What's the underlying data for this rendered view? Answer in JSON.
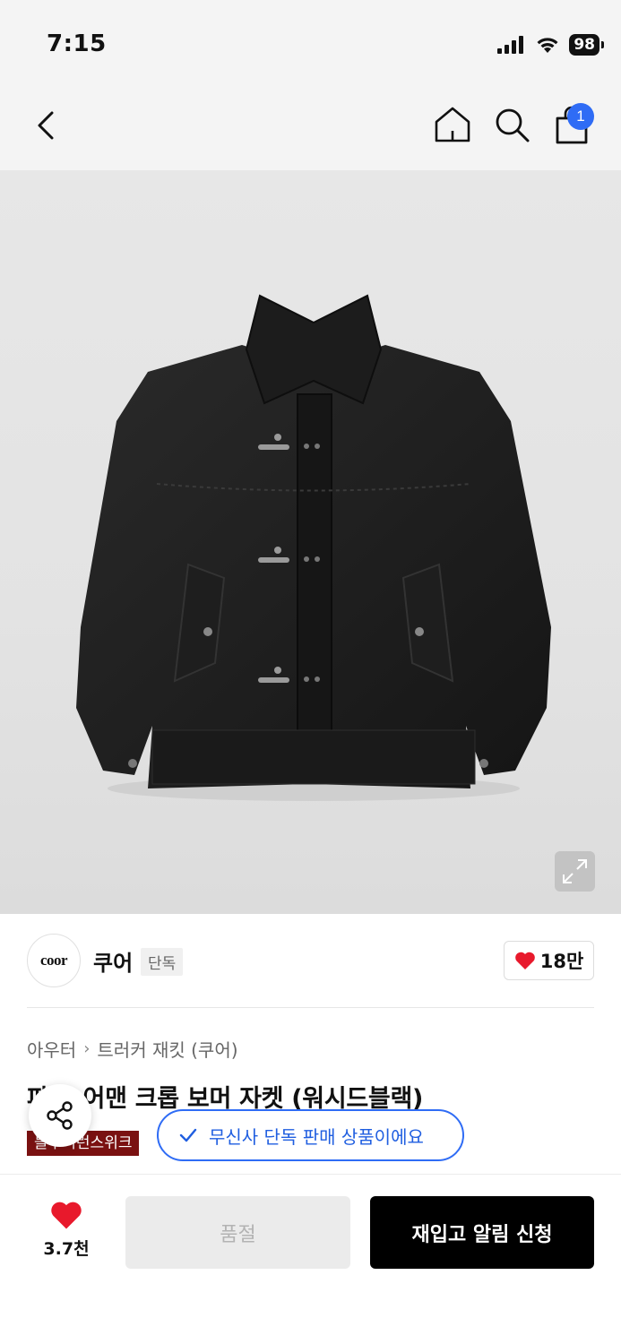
{
  "status_bar": {
    "time": "7:15",
    "battery": "98",
    "icons": [
      "cellular-signal-icon",
      "wifi-icon",
      "battery-icon"
    ]
  },
  "nav": {
    "icons": [
      "back-arrow-icon",
      "home-icon",
      "search-icon",
      "shopping-bag-icon"
    ],
    "cart_badge": "1"
  },
  "product_image": {
    "description_icon": "expand-icon"
  },
  "brand": {
    "logo_text": "coor",
    "name": "쿠어",
    "tag": "단독",
    "likes": "18만"
  },
  "breadcrumb": {
    "category": "아우터",
    "subcategory": "트러커 재킷 (쿠어)"
  },
  "product": {
    "title_visible_part": "어맨 크롭 보머 자켓 (워시드블랙)",
    "title_leading_fragment": "파",
    "promo_tag": "블루퍼런스위크"
  },
  "toast": {
    "text": "무신사 단독 판매 상품이에요"
  },
  "bottom_bar": {
    "wish_count": "3.7천",
    "soldout_label": "품절",
    "restock_label": "재입고 알림 신청"
  },
  "colors": {
    "accent_blue": "#2f6cf5",
    "heart_red": "#e8192c",
    "promo_red": "#7a1111",
    "primary_black": "#000000"
  }
}
